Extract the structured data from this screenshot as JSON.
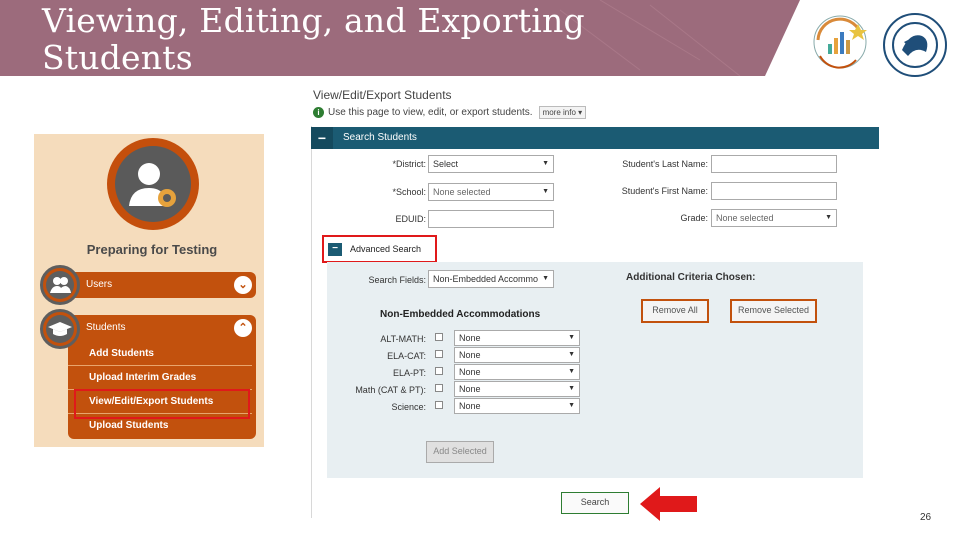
{
  "slide": {
    "title_line1": "Viewing, Editing, and Exporting",
    "title_line2": "Students",
    "page_number": "26",
    "colors": {
      "banner": "#9c6b7c",
      "accent": "#c2510d",
      "section_bar": "#1b5b73",
      "highlight": "#e0191a"
    }
  },
  "sidebar": {
    "heading": "Preparing for Testing",
    "users_label": "Users",
    "students_label": "Students",
    "submenu": [
      {
        "label": "Add Students"
      },
      {
        "label": "Upload Interim Grades"
      },
      {
        "label": "View/Edit/Export Students"
      },
      {
        "label": "Upload Students"
      }
    ]
  },
  "page": {
    "title": "View/Edit/Export Students",
    "info_text": "Use this page to view, edit, or export students.",
    "more_info": "more info",
    "section_title": "Search Students",
    "fields": {
      "district_label": "*District:",
      "district_value": "Select",
      "school_label": "*School:",
      "school_value": "None selected",
      "eduid_label": "EDUID:",
      "last_name_label": "Student's Last Name:",
      "first_name_label": "Student's First Name:",
      "grade_label": "Grade:",
      "grade_value": "None selected"
    },
    "advanced": {
      "toggle_label": "Advanced Search",
      "search_fields_label": "Search Fields:",
      "search_fields_value": "Non-Embedded Accommo",
      "criteria_heading": "Additional Criteria Chosen:",
      "remove_all": "Remove All",
      "remove_selected": "Remove Selected",
      "nea_heading": "Non-Embedded Accommodations",
      "rows": [
        {
          "label": "ALT-MATH:",
          "value": "None"
        },
        {
          "label": "ELA-CAT:",
          "value": "None"
        },
        {
          "label": "ELA-PT:",
          "value": "None"
        },
        {
          "label": "Math (CAT & PT):",
          "value": "None"
        },
        {
          "label": "Science:",
          "value": "None"
        }
      ],
      "add_selected": "Add Selected"
    },
    "search_button": "Search"
  }
}
